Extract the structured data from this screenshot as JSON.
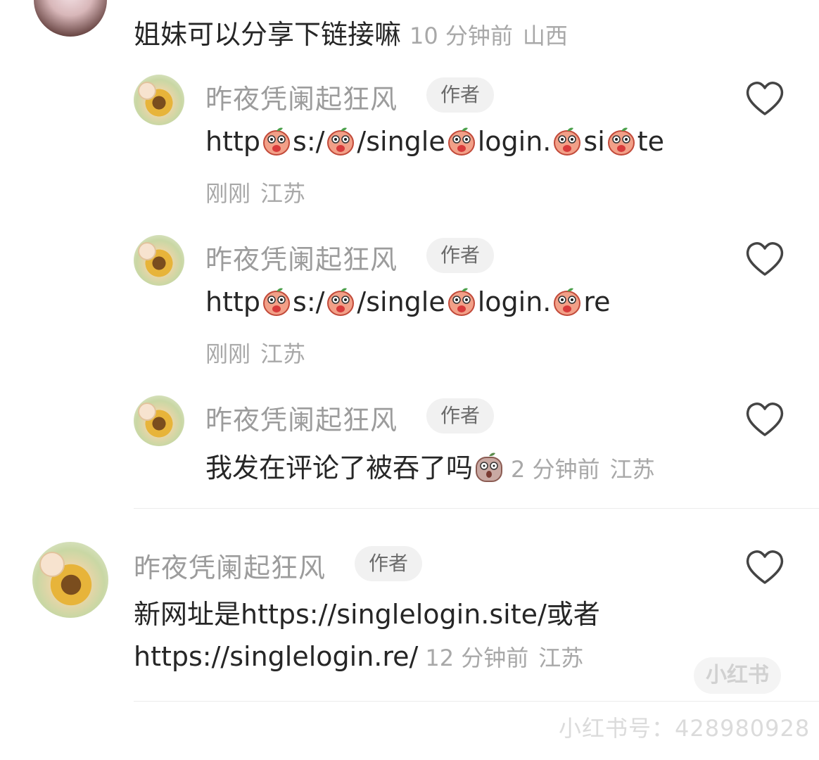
{
  "top_comment": {
    "text": "姐妹可以分享下链接嘛",
    "time": "10 分钟前",
    "location": "山西"
  },
  "replies": [
    {
      "author": "昨夜凭阑起狂风",
      "badge": "作者",
      "segments": [
        "http",
        "s:/",
        "/single",
        "login.",
        "si",
        "te"
      ],
      "time": "刚刚",
      "location": "江苏"
    },
    {
      "author": "昨夜凭阑起狂风",
      "badge": "作者",
      "segments": [
        "http",
        "s:/",
        "/single",
        "login.",
        "re"
      ],
      "time": "刚刚",
      "location": "江苏"
    },
    {
      "author": "昨夜凭阑起狂风",
      "badge": "作者",
      "text": "我发在评论了被吞了吗",
      "time": "2 分钟前",
      "location": "江苏"
    }
  ],
  "comment": {
    "author": "昨夜凭阑起狂风",
    "badge": "作者",
    "line1": "新网址是https://singlelogin.site/或者",
    "line2": "https://singlelogin.re/",
    "time": "12 分钟前",
    "location": "江苏"
  },
  "watermark": {
    "brand": "小红书",
    "id_text": "小红书号：428980928"
  },
  "icons": {
    "like": "heart-outline-icon",
    "emoji": "peach-emoji-icon"
  },
  "colors": {
    "author": "#9c9c9c",
    "text": "#262626",
    "meta": "#a8a8a8",
    "badge_bg": "#f1f1f1"
  }
}
